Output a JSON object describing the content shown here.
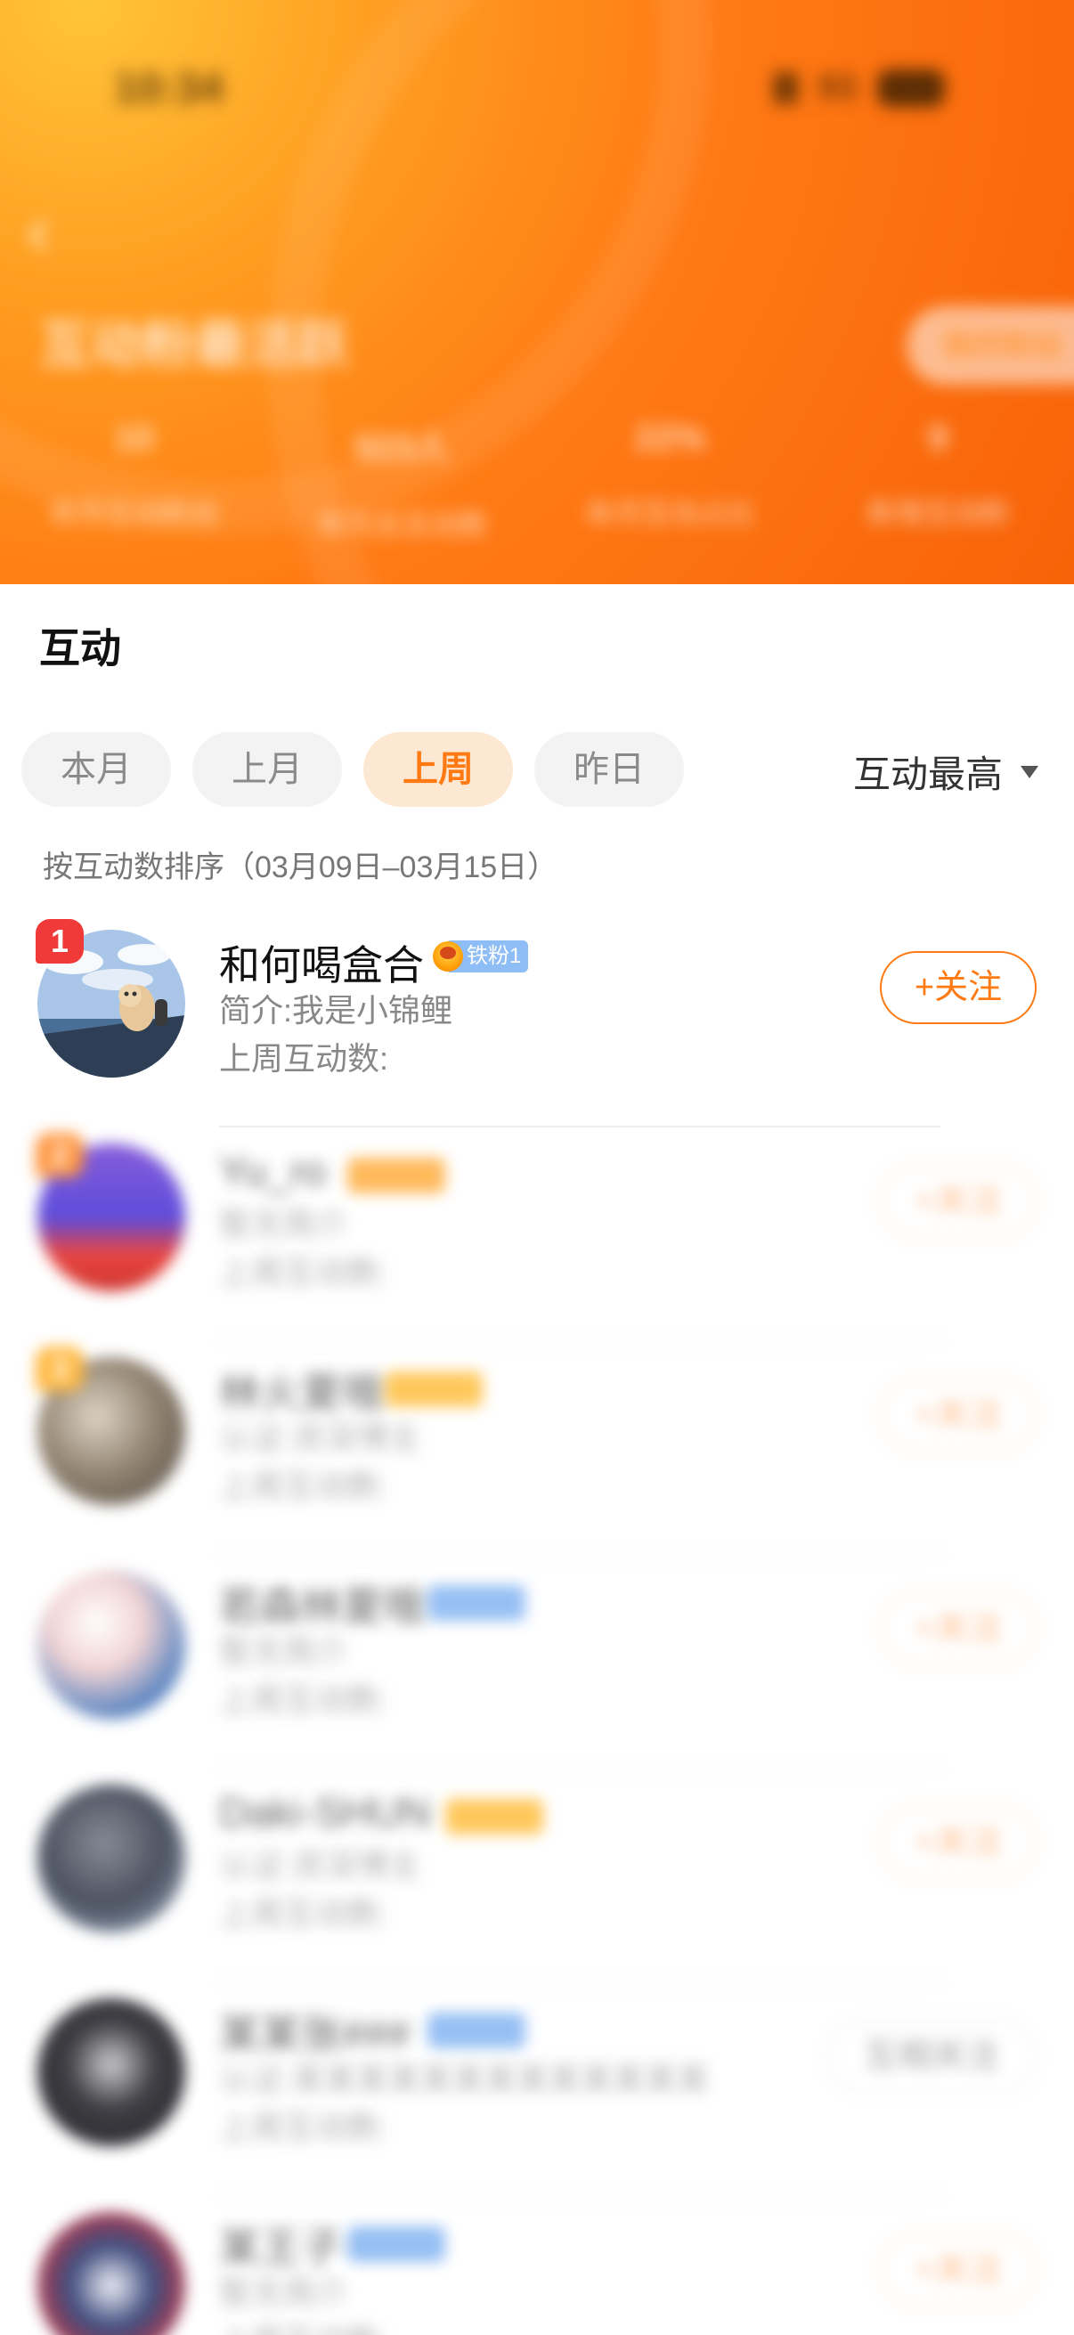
{
  "status_bar": {
    "time": "10:34",
    "battery": "93"
  },
  "header": {
    "title": "互动粉最活跃",
    "action": "我的粉丝",
    "stats": [
      {
        "value": "10",
        "label": "本月互动粉丝"
      },
      {
        "value": "923人",
        "label": "本月总互动数"
      },
      {
        "value": "22%",
        "label": "本月互动占比"
      },
      {
        "value": "9",
        "label": "新增互动粉"
      }
    ]
  },
  "section": {
    "title": "互动",
    "filters": [
      "本月",
      "上月",
      "上周",
      "昨日"
    ],
    "active_filter": "上周",
    "sort_label": "互动最高",
    "range_note": "按互动数排序（03月09日–03月15日）"
  },
  "colors": {
    "accent": "#ff7a12",
    "chip_active_bg": "#fde8d3",
    "rank_red": "#f03a3a",
    "rank_orange": "#ff8a2a"
  },
  "fans": [
    {
      "rank": "1",
      "name": "和何喝盒合",
      "badge": "铁粉1",
      "bio": "简介:我是小锦鲤",
      "interaction": "上周互动数:",
      "button": "+关注"
    },
    {
      "rank": "2",
      "name": "Yu_ro",
      "badge": "铁粉",
      "bio": "暂无简介",
      "interaction": "上周互动数:",
      "button": "+关注"
    },
    {
      "rank": "3",
      "name": "林火夏哦",
      "badge": "铁粉",
      "bio": "认证:资深博主",
      "interaction": "上周互动数:",
      "button": "+关注"
    },
    {
      "rank": "",
      "name": "若森林夏哦",
      "badge": "粉丝",
      "bio": "暂无简介",
      "interaction": "上周互动数:",
      "button": "+关注"
    },
    {
      "rank": "",
      "name": "Daki-SHUN",
      "badge": "铁粉",
      "bio": "认证:资深博主",
      "interaction": "上周互动数:",
      "button": "+关注"
    },
    {
      "rank": "",
      "name": "某某张###",
      "badge": "粉丝",
      "bio": "认证:某某某某某某某某某某某某某",
      "interaction": "上周互动数:",
      "button": "互相关注"
    },
    {
      "rank": "",
      "name": "某王子",
      "badge": "粉丝",
      "bio": "暂无简介",
      "interaction": "上周互动数:",
      "button": "+关注"
    }
  ]
}
